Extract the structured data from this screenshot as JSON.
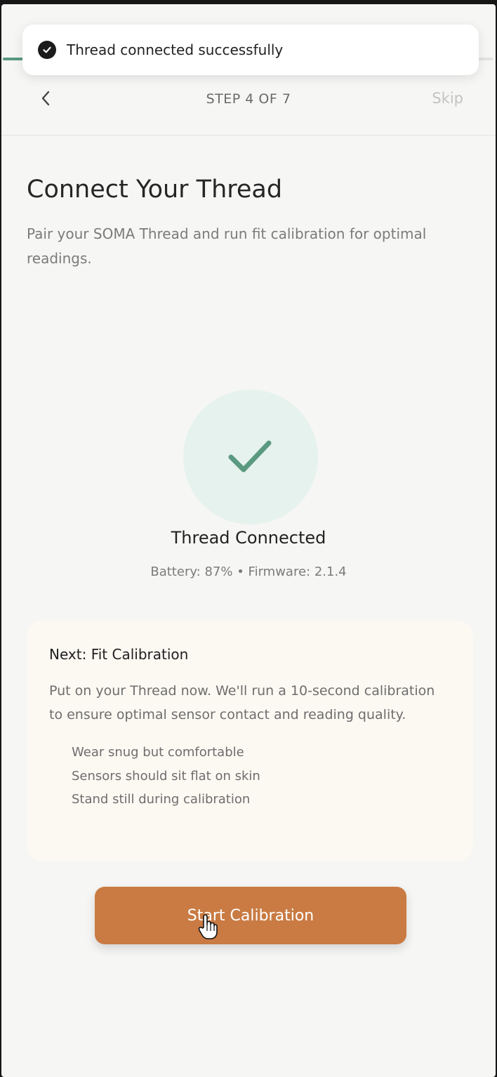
{
  "toast": {
    "text": "Thread connected successfully",
    "icon": "check-circle-icon"
  },
  "header": {
    "step_label": "STEP 4 OF 7",
    "skip_label": "Skip",
    "back_icon": "chevron-left-icon"
  },
  "progress": {
    "fraction": 0.571
  },
  "main": {
    "title": "Connect Your Thread",
    "subtitle": "Pair your SOMA Thread and run fit calibration for optimal readings."
  },
  "status": {
    "icon": "check-icon",
    "title": "Thread Connected",
    "details": "Battery: 87% • Firmware: 2.1.4"
  },
  "calibration_card": {
    "title": "Next: Fit Calibration",
    "body": "Put on your Thread now. We'll run a 10-second calibration to ensure optimal sensor contact and reading quality.",
    "tips": [
      "Wear snug but comfortable",
      "Sensors should sit flat on skin",
      "Stand still during calibration"
    ]
  },
  "cta": {
    "label": "Start Calibration"
  },
  "colors": {
    "accent": "#c97b43",
    "success": "#5a9a80",
    "success_bg": "#e6f2ee",
    "card_bg": "#fcf8f2"
  }
}
